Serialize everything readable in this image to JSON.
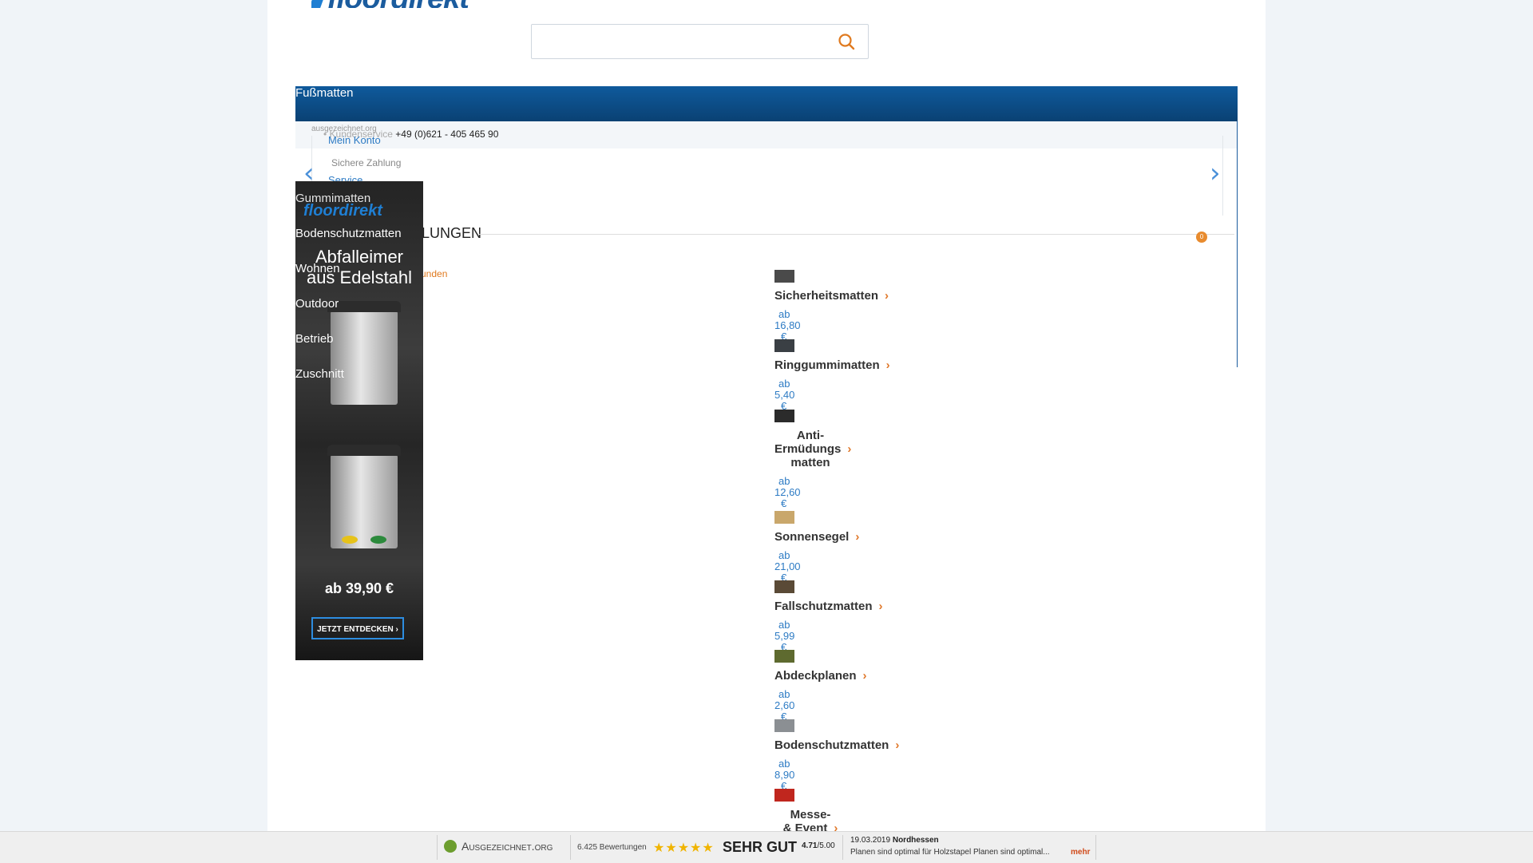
{
  "header": {
    "logo_text": "floordirekt",
    "search": {
      "placeholder": ""
    }
  },
  "nav": {
    "active_label": "Fußmatten"
  },
  "subbar": {
    "ausgezeichnet_small": "ausgezeichnet.org",
    "hotline_prefix": "• Kundenservice",
    "hotline_number": "+49 (0)621 - 405 465 90",
    "mein_konto": "Mein Konto",
    "sichere_zahlung": "Sichere Zahlung",
    "service": "Service"
  },
  "slider": {
    "prev_glyph": "‹",
    "next_glyph": "›"
  },
  "section": {
    "title": "LUNGEN",
    "cart_count": "0",
    "link": "unden"
  },
  "sidebar": {
    "items": [
      {
        "label": "Gummimatten"
      },
      {
        "label": "Bodenschutzmatten"
      },
      {
        "label": "Wohnen"
      },
      {
        "label": "Outdoor"
      },
      {
        "label": "Betrieb"
      },
      {
        "label": "Zuschnitt"
      }
    ]
  },
  "ad": {
    "logo": "floordirekt",
    "headline_1": "Abfalleimer",
    "headline_2": "aus Edelstahl",
    "price": "ab 39,90 €",
    "cta": "JETZT ENTDECKEN ›"
  },
  "categories": [
    {
      "name": "Sicherheitsmatten",
      "ab": "ab",
      "price": "16,80",
      "cur": "€",
      "thumb_color": "#4a4a4a"
    },
    {
      "name": "Ringgummimatten",
      "ab": "ab",
      "price": "5,40",
      "cur": "€",
      "thumb_color": "#3a3f44"
    },
    {
      "name_lines": [
        "Anti-",
        "Ermüdungs",
        "matten"
      ],
      "ab": "ab",
      "price": "12,60",
      "cur": "€",
      "thumb_color": "#2b2b2b"
    },
    {
      "name": "Sonnensegel",
      "ab": "ab",
      "price": "21,00",
      "cur": "€",
      "thumb_color": "#c9a76b"
    },
    {
      "name": "Fallschutzmatten",
      "ab": "ab",
      "price": "5,99",
      "cur": "€",
      "thumb_color": "#5a4a36"
    },
    {
      "name": "Abdeckplanen",
      "ab": "ab",
      "price": "2,60",
      "cur": "€",
      "thumb_color": "#5e6a2f"
    },
    {
      "name": "Bodenschutzmatten",
      "ab": "ab",
      "price": "8,90",
      "cur": "€",
      "thumb_color": "#8b8f93"
    },
    {
      "name_lines": [
        "Messe-",
        "& Event"
      ],
      "thumb_color": "#c0261e"
    }
  ],
  "footer": {
    "brand": "Ausgezeichnet.org",
    "count": "6.425 Bewertungen",
    "stars": "★★★★★",
    "rating_label": "SEHR GUT",
    "score": "4.71",
    "score_max": "/5.00",
    "review_date": "19.03.2019",
    "review_region": "Nordhessen",
    "review_text": "Planen sind optimal für Holzstapel Planen sind optimal...",
    "more": "mehr"
  }
}
